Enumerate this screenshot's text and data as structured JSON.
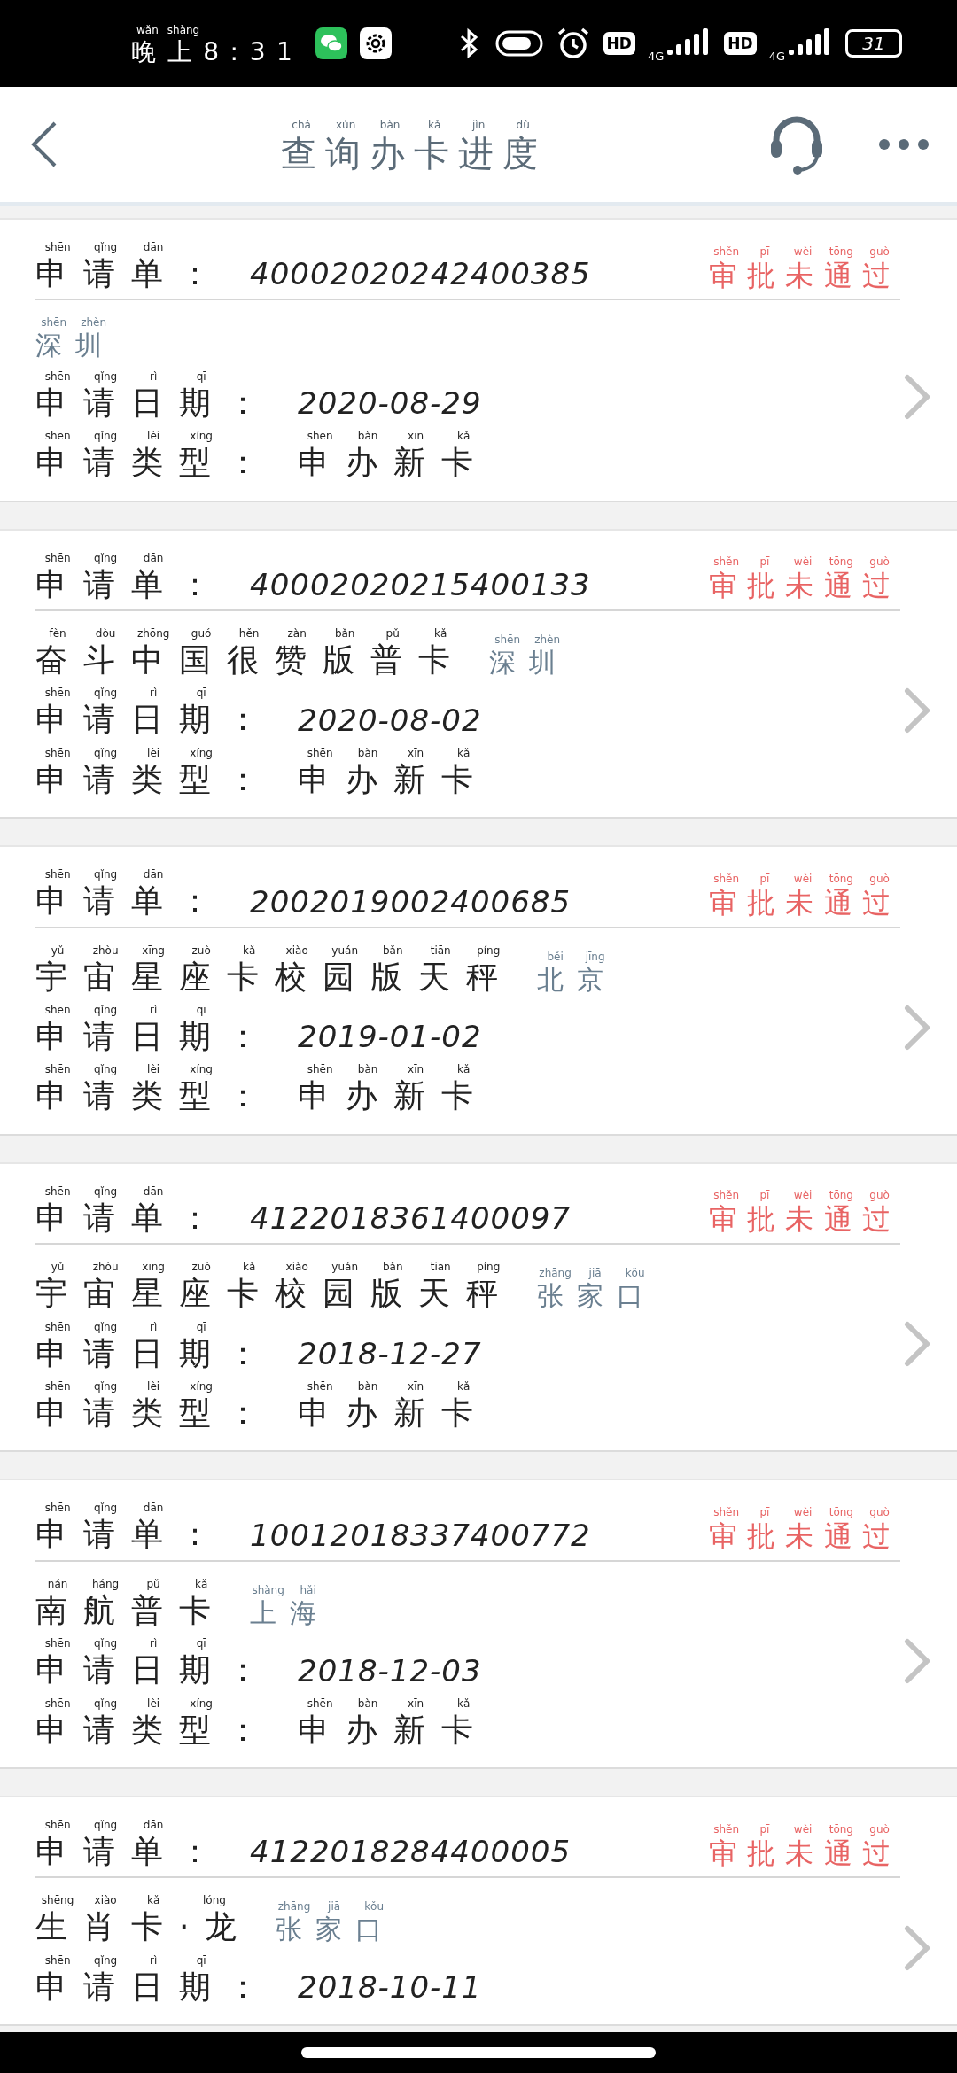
{
  "status_bar": {
    "time": {
      "text": "晚上8:31",
      "pinyin": "wǎn shàng"
    },
    "hd_1": "HD",
    "network_1": "4G",
    "hd_2": "HD",
    "network_2": "4G",
    "battery": "31"
  },
  "header": {
    "title": {
      "text": "查询办卡进度",
      "pinyin": "chá xún bàn kǎ jìn dù"
    }
  },
  "applications": [
    {
      "order_label": {
        "text": "申请单：",
        "pinyin": "shēn qǐng dān"
      },
      "order_number": "40002020242400385",
      "status": {
        "text": "审批未通过",
        "pinyin": "shěn pī wèi tōng guò"
      },
      "city": {
        "text": "深圳",
        "pinyin": "shēn zhèn"
      },
      "date_label": {
        "text": "申请日期：",
        "pinyin": "shēn qǐng rì qī"
      },
      "date": "2020-08-29",
      "type_label": {
        "text": "申请类型：",
        "pinyin": "shēn qǐng lèi xíng"
      },
      "type": {
        "text": "申办新卡",
        "pinyin": "shēn bàn xīn kǎ"
      }
    },
    {
      "order_label": {
        "text": "申请单：",
        "pinyin": "shēn qǐng dān"
      },
      "order_number": "40002020215400133",
      "status": {
        "text": "审批未通过",
        "pinyin": "shěn pī wèi tōng guò"
      },
      "card_name": {
        "text": "奋斗中国很赞版普卡",
        "pinyin": "fèn dòu zhōng guó hěn zàn bǎn pǔ kǎ"
      },
      "city": {
        "text": "深圳",
        "pinyin": "shēn zhèn"
      },
      "date_label": {
        "text": "申请日期：",
        "pinyin": "shēn qǐng rì qī"
      },
      "date": "2020-08-02",
      "type_label": {
        "text": "申请类型：",
        "pinyin": "shēn qǐng lèi xíng"
      },
      "type": {
        "text": "申办新卡",
        "pinyin": "shēn bàn xīn kǎ"
      }
    },
    {
      "order_label": {
        "text": "申请单：",
        "pinyin": "shēn qǐng dān"
      },
      "order_number": "2002019002400685",
      "status": {
        "text": "审批未通过",
        "pinyin": "shěn pī wèi tōng guò"
      },
      "card_name": {
        "text": "宇宙星座卡校园版天秤",
        "pinyin": "yǔ zhòu xīng zuò kǎ xiào yuán bǎn tiān píng"
      },
      "city": {
        "text": "北京",
        "pinyin": "běi jīng"
      },
      "date_label": {
        "text": "申请日期：",
        "pinyin": "shēn qǐng rì qī"
      },
      "date": "2019-01-02",
      "type_label": {
        "text": "申请类型：",
        "pinyin": "shēn qǐng lèi xíng"
      },
      "type": {
        "text": "申办新卡",
        "pinyin": "shēn bàn xīn kǎ"
      }
    },
    {
      "order_label": {
        "text": "申请单：",
        "pinyin": "shēn qǐng dān"
      },
      "order_number": "4122018361400097",
      "status": {
        "text": "审批未通过",
        "pinyin": "shěn pī wèi tōng guò"
      },
      "card_name": {
        "text": "宇宙星座卡校园版天秤",
        "pinyin": "yǔ zhòu xīng zuò kǎ xiào yuán bǎn tiān píng"
      },
      "city": {
        "text": "张家口",
        "pinyin": "zhāng jiā kǒu"
      },
      "date_label": {
        "text": "申请日期：",
        "pinyin": "shēn qǐng rì qī"
      },
      "date": "2018-12-27",
      "type_label": {
        "text": "申请类型：",
        "pinyin": "shēn qǐng lèi xíng"
      },
      "type": {
        "text": "申办新卡",
        "pinyin": "shēn bàn xīn kǎ"
      }
    },
    {
      "order_label": {
        "text": "申请单：",
        "pinyin": "shēn qǐng dān"
      },
      "order_number": "10012018337400772",
      "status": {
        "text": "审批未通过",
        "pinyin": "shěn pī wèi tōng guò"
      },
      "card_name": {
        "text": "南航普卡",
        "pinyin": "nán háng pǔ kǎ"
      },
      "city": {
        "text": "上海",
        "pinyin": "shàng hǎi"
      },
      "date_label": {
        "text": "申请日期：",
        "pinyin": "shēn qǐng rì qī"
      },
      "date": "2018-12-03",
      "type_label": {
        "text": "申请类型：",
        "pinyin": "shēn qǐng lèi xíng"
      },
      "type": {
        "text": "申办新卡",
        "pinyin": "shēn bàn xīn kǎ"
      }
    },
    {
      "order_label": {
        "text": "申请单：",
        "pinyin": "shēn qǐng dān"
      },
      "order_number": "4122018284400005",
      "status": {
        "text": "审批未通过",
        "pinyin": "shěn pī wèi tōng guò"
      },
      "card_name": {
        "text": "生肖卡·龙",
        "pinyin": "shēng xiào kǎ lóng"
      },
      "city": {
        "text": "张家口",
        "pinyin": "zhāng jiā kǒu"
      },
      "date_label": {
        "text": "申请日期：",
        "pinyin": "shēn qǐng rì qī"
      },
      "date": "2018-10-11"
    }
  ]
}
